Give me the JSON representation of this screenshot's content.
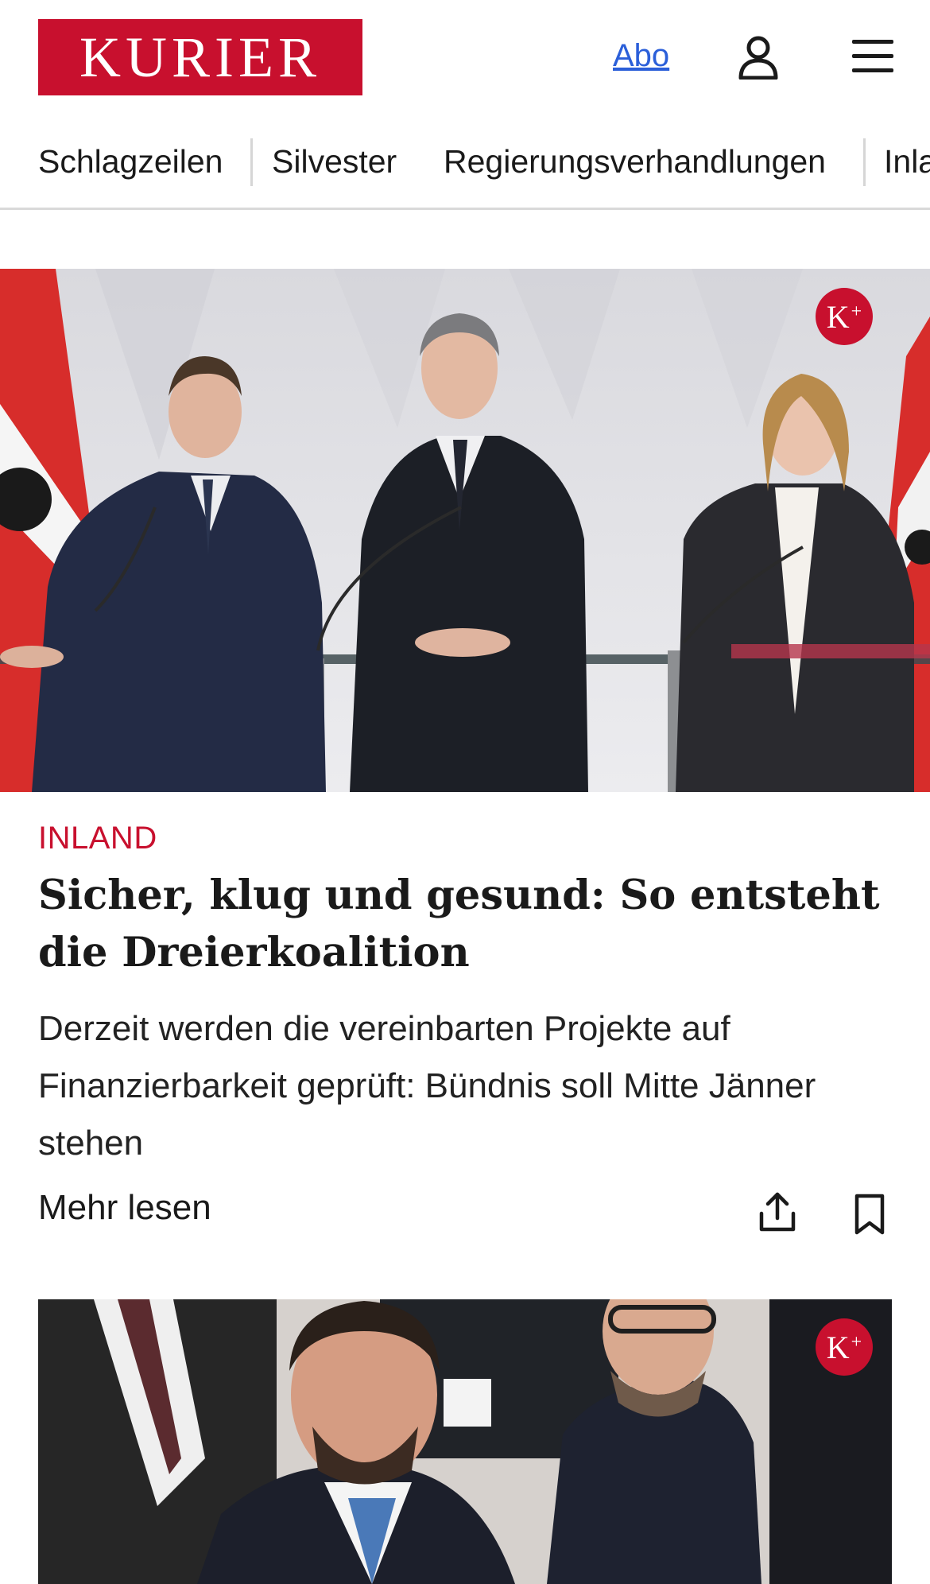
{
  "header": {
    "logo_text": "KURIER",
    "abo_label": "Abo",
    "brand_color": "#c8102e"
  },
  "nav": {
    "items": [
      "Schlagzeilen",
      "Silvester",
      "Regierungsverhandlungen",
      "Inla"
    ]
  },
  "article": {
    "badge": "K",
    "badge_plus": "+",
    "category": "INLAND",
    "headline": "Sicher, klug und gesund: So entsteht die Dreierkoalition",
    "teaser": "Derzeit werden die vereinbarten Projekte auf Finanzierbarkeit geprüft: Bündnis soll Mitte Jänner stehen",
    "more_label": "Mehr lesen"
  },
  "article2": {
    "badge": "K",
    "badge_plus": "+"
  },
  "icons": {
    "user": "user-icon",
    "menu": "hamburger-menu-icon",
    "share": "share-icon",
    "bookmark": "bookmark-icon"
  }
}
